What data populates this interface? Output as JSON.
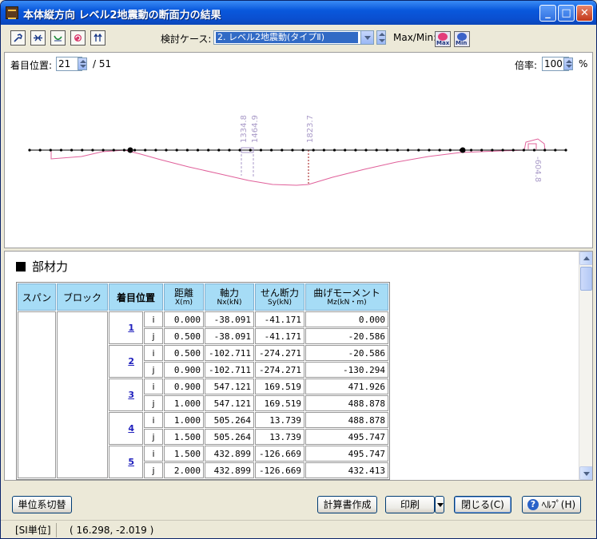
{
  "window": {
    "title": "本体縦方向 レベル2地震動の断面力の結果",
    "controls": [
      "minimize",
      "maximize",
      "close"
    ]
  },
  "toolbar": {
    "tool_icons": [
      "wrench-icon",
      "connect-icon",
      "curve-icon",
      "refresh-icon",
      "arrow-up-icon"
    ],
    "case_label": "検討ケース:",
    "case_value": "2. レベル2地震動(タイプⅡ)",
    "maxmin_label": "Max/Min:",
    "max_label": "Max",
    "min_label": "Min"
  },
  "view": {
    "position_label": "着目位置:",
    "position_value": "21",
    "position_total": "/ 51",
    "zoom_label": "倍率:",
    "zoom_value": "100",
    "zoom_unit": "%",
    "labels": [
      "1334.8",
      "1464.9",
      "1823.7",
      "-604.8"
    ]
  },
  "section": {
    "title": "部材力"
  },
  "table": {
    "headers": {
      "span": "スパン",
      "block": "ブロック",
      "point": "着目位置",
      "dist_main": "距離",
      "dist_sub": "X(m)",
      "axial_main": "軸力",
      "axial_sub": "Nx(kN)",
      "shear_main": "せん断力",
      "shear_sub": "Sy(kN)",
      "moment_main": "曲げモーメント",
      "moment_sub": "Mz(kN・m)"
    },
    "rows": [
      {
        "no": "1",
        "end": "i",
        "x": "0.000",
        "nx": "-38.091",
        "sy": "-41.171",
        "mz": "0.000"
      },
      {
        "no": "",
        "end": "j",
        "x": "0.500",
        "nx": "-38.091",
        "sy": "-41.171",
        "mz": "-20.586"
      },
      {
        "no": "2",
        "end": "i",
        "x": "0.500",
        "nx": "-102.711",
        "sy": "-274.271",
        "mz": "-20.586"
      },
      {
        "no": "",
        "end": "j",
        "x": "0.900",
        "nx": "-102.711",
        "sy": "-274.271",
        "mz": "-130.294"
      },
      {
        "no": "3",
        "end": "i",
        "x": "0.900",
        "nx": "547.121",
        "sy": "169.519",
        "mz": "471.926"
      },
      {
        "no": "",
        "end": "j",
        "x": "1.000",
        "nx": "547.121",
        "sy": "169.519",
        "mz": "488.878"
      },
      {
        "no": "4",
        "end": "i",
        "x": "1.000",
        "nx": "505.264",
        "sy": "13.739",
        "mz": "488.878"
      },
      {
        "no": "",
        "end": "j",
        "x": "1.500",
        "nx": "505.264",
        "sy": "13.739",
        "mz": "495.747"
      },
      {
        "no": "5",
        "end": "i",
        "x": "1.500",
        "nx": "432.899",
        "sy": "-126.669",
        "mz": "495.747"
      },
      {
        "no": "",
        "end": "j",
        "x": "2.000",
        "nx": "432.899",
        "sy": "-126.669",
        "mz": "432.413"
      }
    ]
  },
  "buttons": {
    "unit_switch": "単位系切替",
    "report": "計算書作成",
    "print": "印刷",
    "close": "閉じる(C)",
    "help": "ﾍﾙﾌﾟ(H)"
  },
  "status": {
    "unit": "[SI単位]",
    "coords": "( 16.298, -2.019 )"
  },
  "colors": {
    "diagram_line": "#e0609a",
    "label_color": "#a99ac8",
    "header_bg": "#a6dcf6"
  }
}
